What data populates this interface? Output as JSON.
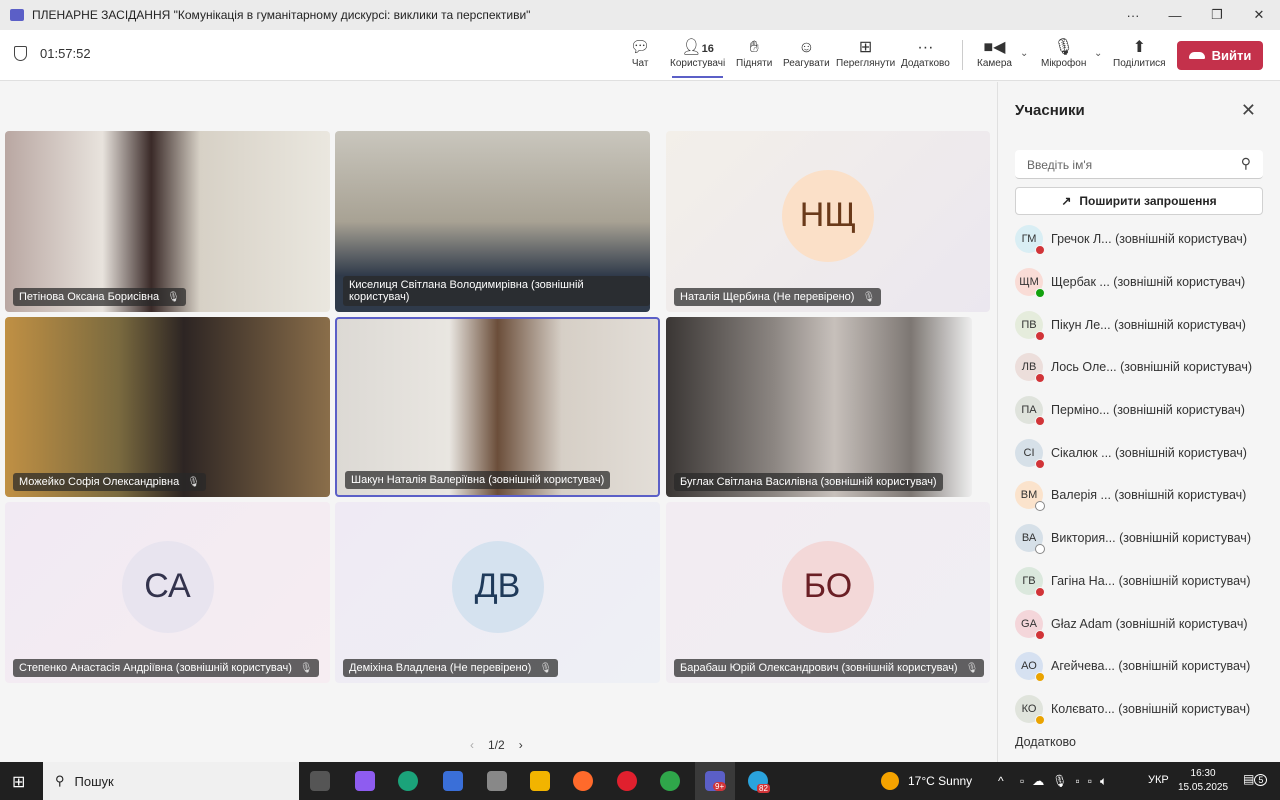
{
  "window": {
    "title": "ПЛЕНАРНЕ ЗАСІДАННЯ \"Комунікація в гуманітарному дискурсі: виклики та перспективи\"",
    "controls": [
      "···",
      "—",
      "❐",
      "✕"
    ]
  },
  "toolbar": {
    "timer": "01:57:52",
    "participants_count": "16",
    "items": [
      "Чат",
      "Користувачі",
      "Підняти",
      "Реагувати",
      "Переглянути",
      "Додатково",
      "Камера",
      "Мікрофон",
      "Поділитися"
    ],
    "leave": "Вийти"
  },
  "tiles": [
    {
      "name": "Петінова Оксана Борисівна"
    },
    {
      "name": "Киселиця Світлана Володимирівна (зовнішній користувач)"
    },
    {
      "name": "Наталія Щербина (Не перевірено)",
      "initials": "НЩ"
    },
    {
      "name": "Можейко Софія Олександрівна"
    },
    {
      "name": "Шакун Наталія Валеріївна (зовнішній користувач)"
    },
    {
      "name": "Буглак Світлана Василівна (зовнішній користувач)"
    },
    {
      "name": "Степенко Анастасія Андріївна (зовнішній користувач)",
      "initials": "СА"
    },
    {
      "name": "Деміхіна Владлена (Не перевірено)",
      "initials": "ДВ"
    },
    {
      "name": "Барабаш Юрій Олександрович (зовнішній користувач)",
      "initials": "БО"
    }
  ],
  "pager": {
    "label": "1/2"
  },
  "panel": {
    "title": "Учасники",
    "search_placeholder": "Введіть ім'я",
    "share": "Поширити запрошення",
    "more": "Додатково",
    "participants": [
      {
        "initials": "ГМ",
        "name": "Гречок Л...",
        "tag": "(зовнішній користувач)",
        "status": "busy",
        "color": "#d9eef4"
      },
      {
        "initials": "ЩМ",
        "name": "Щербак ...",
        "tag": "(зовнішній користувач)",
        "status": "available",
        "color": "#f9dcd6"
      },
      {
        "initials": "ПВ",
        "name": "Пікун Ле...",
        "tag": "(зовнішній користувач)",
        "status": "busy",
        "color": "#e5ecdc"
      },
      {
        "initials": "ЛВ",
        "name": "Лось Оле...",
        "tag": "(зовнішній користувач)",
        "status": "busy",
        "color": "#ecdedb"
      },
      {
        "initials": "ПА",
        "name": "Перміно...",
        "tag": "(зовнішній користувач)",
        "status": "busy",
        "color": "#dfe3dc"
      },
      {
        "initials": "СІ",
        "name": "Сікалюк ...",
        "tag": "(зовнішній користувач)",
        "status": "busy",
        "color": "#d6e0e8"
      },
      {
        "initials": "ВМ",
        "name": "Валерія ...",
        "tag": "(зовнішній користувач)",
        "status": "offline",
        "color": "#fbe3cc"
      },
      {
        "initials": "ВА",
        "name": "Виктория...",
        "tag": "(зовнішній користувач)",
        "status": "offline",
        "color": "#d6e0e8"
      },
      {
        "initials": "ГВ",
        "name": "Гагіна На...",
        "tag": "(зовнішній користувач)",
        "status": "busy",
        "color": "#dbe8dd"
      },
      {
        "initials": "GA",
        "name": "Głaz Adam",
        "tag": "(зовнішній користувач)",
        "status": "busy",
        "color": "#f4d6da"
      },
      {
        "initials": "АО",
        "name": "Агейчева...",
        "tag": "(зовнішній користувач)",
        "status": "away",
        "color": "#d6e1f1"
      },
      {
        "initials": "КО",
        "name": "Колєвато...",
        "tag": "(зовнішній користувач)",
        "status": "away",
        "color": "#e0e4dc"
      }
    ]
  },
  "status_colors": {
    "busy": "#d13438",
    "available": "#13a10e",
    "away": "#eaa300",
    "offline": "#ffffff"
  },
  "taskbar": {
    "search": "Пошук",
    "weather": "17°C  Sunny",
    "lang": "УКР",
    "time": "16:30",
    "date": "15.05.2025",
    "teams_badge": "9+",
    "telegram_badge": "82",
    "notif_count": "5"
  }
}
